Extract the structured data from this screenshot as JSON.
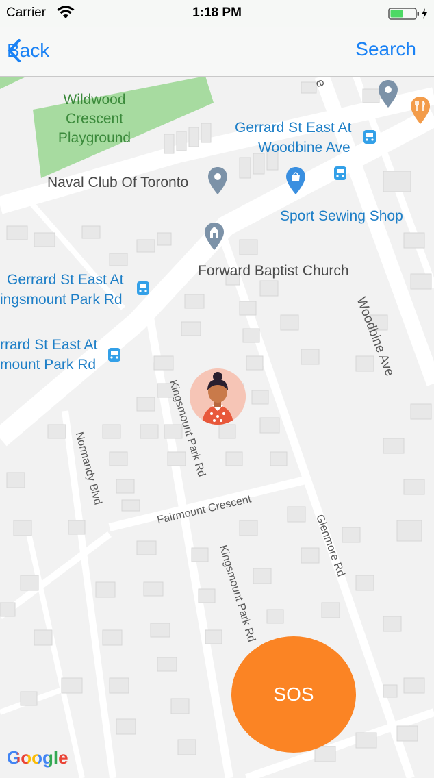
{
  "status_bar": {
    "carrier": "Carrier",
    "time": "1:18 PM"
  },
  "nav": {
    "back_label": "Back",
    "search_label": "Search"
  },
  "map": {
    "park": {
      "line1": "Wildwood",
      "line2": "Crescent",
      "line3": "Playground"
    },
    "pois": {
      "stop_gerrard_woodbine_1": "Gerrard St East At",
      "stop_gerrard_woodbine_2": "Woodbine Ave",
      "naval_club": "Naval Club Of Toronto",
      "sport_sewing": "Sport Sewing Shop",
      "forward_baptist": "Forward Baptist Church",
      "stop_kingsmount_1": "Gerrard St East At",
      "stop_kingsmount_2": "ingsmount Park Rd",
      "stop_kingsmount_b1": "rrard St East At",
      "stop_kingsmount_b2": "mount Park Rd"
    },
    "streets": {
      "woodbine": "Woodbine Ave",
      "kingsmount_upper": "Kingsmount Park Rd",
      "kingsmount_lower": "Kingsmount Park Rd",
      "normandy": "Normandy Blvd",
      "fairmount": "Fairmount Crescent",
      "glenmore": "Glenmore Rd",
      "top_e": "e"
    }
  },
  "sos": {
    "label": "SOS"
  },
  "attribution": {
    "google": "Google"
  },
  "colors": {
    "accent": "#1a82f5",
    "sos": "#fb8424",
    "park": "#a7dba0"
  }
}
